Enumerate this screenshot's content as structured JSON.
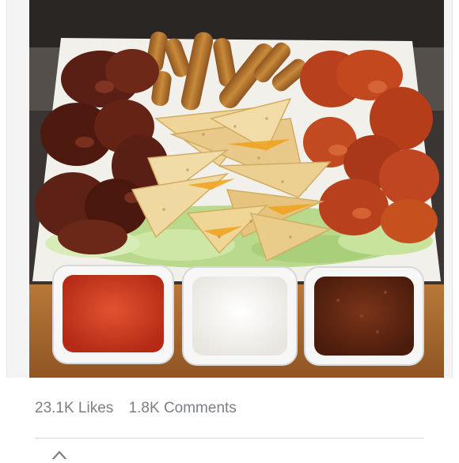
{
  "post": {
    "image_alt": "Platter of appetizers: barbecue wings, buffalo wings, mozzarella sticks, quesadilla wedges on lettuce, with three dipping sauces",
    "likes_label": "23.1K Likes",
    "comments_label": "1.8K Comments"
  },
  "icons": {
    "bottom": "caret-up-icon"
  },
  "colors": {
    "stats_text": "#7b7f86",
    "divider": "#dcdcdc",
    "platter": "#f2f0ea",
    "bbq_wings": "#5a1f14",
    "buffalo_wings": "#b8401c",
    "quesadilla": "#e8c98a",
    "mozzarella_sticks": "#b8762e",
    "lettuce": "#b9d98c",
    "red_sauce": "#c8321c",
    "ranch": "#f4f2ec",
    "bbq_sauce": "#5b2410",
    "table": "#a86a32"
  }
}
